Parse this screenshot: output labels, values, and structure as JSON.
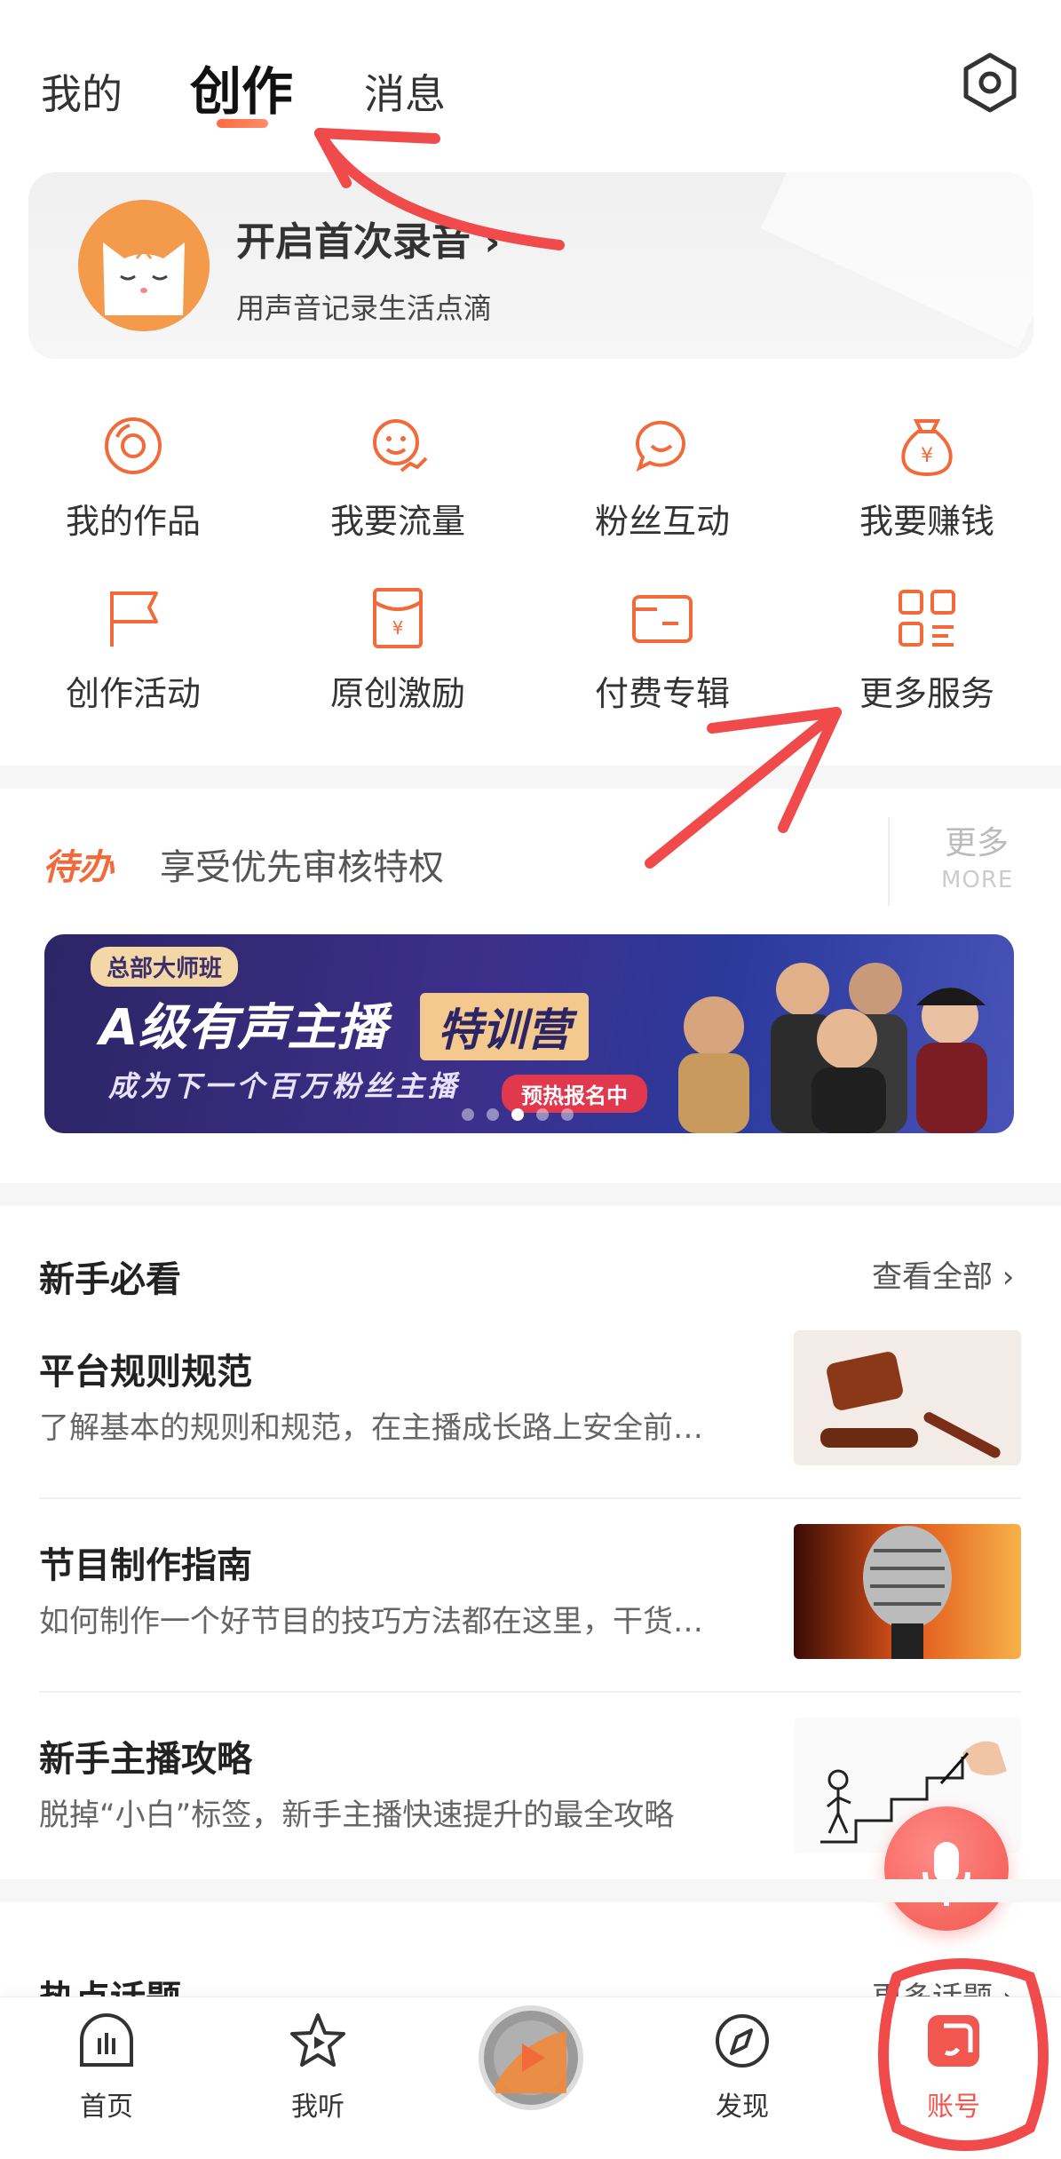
{
  "top_tabs": {
    "mine": "我的",
    "create": "创作",
    "messages": "消息"
  },
  "record_card": {
    "title": "开启首次录音",
    "subtitle": "用声音记录生活点滴"
  },
  "services": [
    {
      "label": "我的作品",
      "icon": "disc-icon"
    },
    {
      "label": "我要流量",
      "icon": "traffic-icon"
    },
    {
      "label": "粉丝互动",
      "icon": "chat-bubble-icon"
    },
    {
      "label": "我要赚钱",
      "icon": "money-bag-icon"
    },
    {
      "label": "创作活动",
      "icon": "flag-icon"
    },
    {
      "label": "原创激励",
      "icon": "red-envelope-icon"
    },
    {
      "label": "付费专辑",
      "icon": "card-icon"
    },
    {
      "label": "更多服务",
      "icon": "grid-icon"
    }
  ],
  "todo": {
    "tag": "待办",
    "text": "享受优先审核特权",
    "more_cn": "更多",
    "more_en": "MORE"
  },
  "banner": {
    "chip": "总部大师班",
    "title": "A级有声主播",
    "badge": "特训营",
    "subtitle": "成为下一个百万粉丝主播",
    "cta": "预热报名中",
    "active_dot_index": 2,
    "dot_count": 5
  },
  "beginner": {
    "title": "新手必看",
    "link": "查看全部",
    "articles": [
      {
        "title": "平台规则规范",
        "desc": "了解基本的规则和规范，在主播成长路上安全前…"
      },
      {
        "title": "节目制作指南",
        "desc": "如何制作一个好节目的技巧方法都在这里，干货…"
      },
      {
        "title": "新手主播攻略",
        "desc": "脱掉“小白”标签，新手主播快速提升的最全攻略"
      }
    ]
  },
  "hot": {
    "title": "热点话题",
    "link": "更多话题"
  },
  "bottom_nav": [
    {
      "label": "首页",
      "icon": "home-icon"
    },
    {
      "label": "我听",
      "icon": "star-play-icon"
    },
    {
      "label": "",
      "icon": "center-play-icon"
    },
    {
      "label": "发现",
      "icon": "compass-icon"
    },
    {
      "label": "账号",
      "icon": "account-icon",
      "active": true
    }
  ],
  "colors": {
    "accent": "#f2574f",
    "orange": "#f26a3a",
    "annotation": "#f04a4a"
  }
}
